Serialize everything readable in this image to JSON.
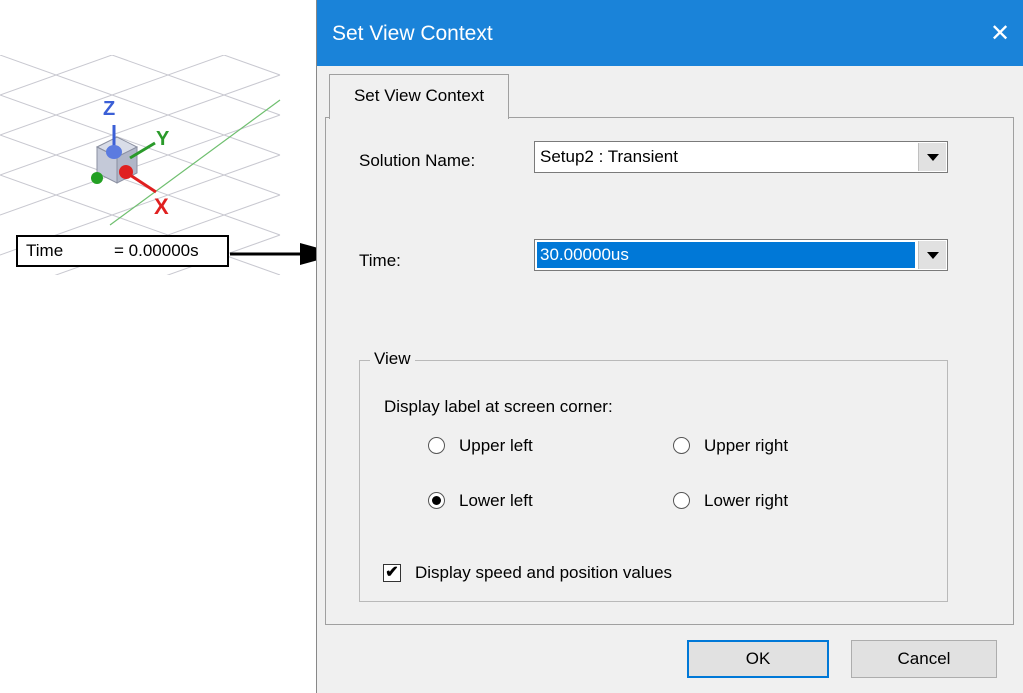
{
  "viewport": {
    "axes": {
      "z": "Z",
      "y": "Y",
      "x": "X"
    },
    "time_label": {
      "name": "Time",
      "value": "= 0.00000s"
    }
  },
  "dialog": {
    "title": "Set View Context",
    "close_glyph": "✕",
    "tab_label": "Set View Context",
    "solution_label": "Solution Name:",
    "solution_value": "Setup2 : Transient",
    "time_label": "Time:",
    "time_value": "30.00000us",
    "view_group": {
      "legend": "View",
      "corner_label": "Display label at screen corner:",
      "options": {
        "upper_left": "Upper left",
        "upper_right": "Upper right",
        "lower_left": "Lower left",
        "lower_right": "Lower right"
      },
      "selected": "Lower left",
      "checkbox_label": "Display speed and position values",
      "checkbox_checked": true,
      "check_glyph": "✔"
    },
    "ok_label": "OK",
    "cancel_label": "Cancel"
  },
  "colors": {
    "titlebar": "#1a83d9",
    "selection": "#0078d7",
    "axis_x": "#e02020",
    "axis_y": "#2a9a2a",
    "axis_z": "#3b5fd6"
  }
}
